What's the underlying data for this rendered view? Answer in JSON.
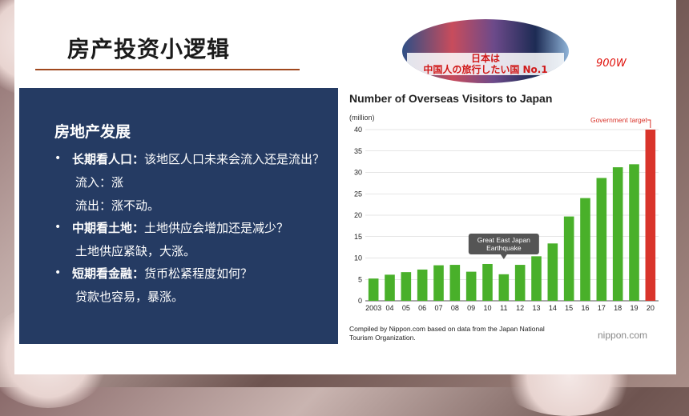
{
  "slide": {
    "title": "房产投资小逻辑",
    "banner_text": "日本は\n中国人の旅行したい国 No.1",
    "annotation": "900W"
  },
  "panel": {
    "heading": "房地产发展",
    "items": [
      {
        "bullet": "•",
        "label": "长期看人口：",
        "text": "该地区人口未来会流入还是流出？",
        "sub": [
          "流入：涨",
          "流出：涨不动。"
        ]
      },
      {
        "bullet": "•",
        "label": "中期看土地：",
        "text": "土地供应会增加还是减少？",
        "sub": [
          "土地供应紧缺，大涨。"
        ]
      },
      {
        "bullet": "•",
        "label": "短期看金融：",
        "text": "货币松紧程度如何？",
        "sub": [
          "贷款也容易，暴涨。"
        ]
      }
    ]
  },
  "chart_data": {
    "type": "bar",
    "title": "Number of Overseas Visitors to Japan",
    "ylabel": "(million)",
    "categories": [
      "2003",
      "04",
      "05",
      "06",
      "07",
      "08",
      "09",
      "10",
      "11",
      "12",
      "13",
      "14",
      "15",
      "16",
      "17",
      "18",
      "19",
      "20"
    ],
    "values": [
      5.2,
      6.1,
      6.7,
      7.3,
      8.3,
      8.4,
      6.8,
      8.6,
      6.2,
      8.4,
      10.4,
      13.4,
      19.7,
      24.0,
      28.7,
      31.2,
      31.9,
      40.0
    ],
    "bar_colors": [
      "#49b02a",
      "#49b02a",
      "#49b02a",
      "#49b02a",
      "#49b02a",
      "#49b02a",
      "#49b02a",
      "#49b02a",
      "#49b02a",
      "#49b02a",
      "#49b02a",
      "#49b02a",
      "#49b02a",
      "#49b02a",
      "#49b02a",
      "#49b02a",
      "#49b02a",
      "#d9342b"
    ],
    "ylim": [
      0,
      40
    ],
    "yticks": [
      0,
      5,
      10,
      15,
      20,
      25,
      30,
      35,
      40
    ],
    "grid": true,
    "annotations": [
      {
        "text": "Government target",
        "category": "20",
        "color": "#d9342b"
      },
      {
        "text": "Great East Japan\nEarthquake",
        "category": "11",
        "color": "#555555"
      }
    ],
    "source": "Compiled by Nippon.com based on data from the Japan National\nTourism Organization.",
    "logo": "nippon.com"
  }
}
